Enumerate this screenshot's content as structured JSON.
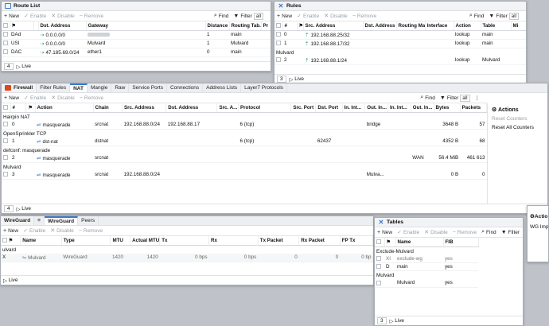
{
  "route_list": {
    "title": "Route List",
    "toolbar": {
      "new": "New",
      "enable": "Enable",
      "disable": "Disable",
      "remove": "Remove",
      "find": "Find",
      "filter": "Filter",
      "filter_value": "all"
    },
    "columns": [
      "",
      "",
      "",
      "Dst. Address",
      "Gateway",
      "Distance",
      "Routing Tab...",
      "Pr"
    ],
    "rows": [
      {
        "flag": "DAd",
        "dst": "0.0.0.0/0",
        "gw": "",
        "dist": "1",
        "table": "main"
      },
      {
        "flag": "USI",
        "dst": "0.0.0.0/0",
        "gw": "Mulvard",
        "dist": "1",
        "table": "Mulvard"
      },
      {
        "flag": "DAC",
        "dst": "47.185.69.0/24",
        "gw": "ether1",
        "dist": "0",
        "table": "main"
      }
    ],
    "footer": {
      "count": "4",
      "live": "Live"
    }
  },
  "rules": {
    "title": "Rules",
    "toolbar": {
      "new": "New",
      "enable": "Enable",
      "disable": "Disable",
      "remove": "Remove",
      "find": "Find",
      "filter": "Filter",
      "filter_value": "all"
    },
    "columns": [
      "",
      "#",
      "",
      "Src. Address",
      "Dst. Address",
      "Routing Mark",
      "Interface",
      "Action",
      "Table",
      "Mi"
    ],
    "rows": [
      {
        "num": "0",
        "src": "192.168.88.25/32",
        "action": "lookup",
        "table": "main"
      },
      {
        "num": "1",
        "src": "192.168.88.17/32",
        "action": "lookup",
        "table": "main"
      }
    ],
    "group": "Mulvard",
    "group_rows": [
      {
        "num": "2",
        "src": "192.168.88.1/24",
        "action": "lookup",
        "table": "Mulvard"
      }
    ],
    "footer": {
      "count": "3",
      "live": "Live"
    }
  },
  "firewall": {
    "title": "Firewall",
    "tabs": [
      "Filter Rules",
      "NAT",
      "Mangle",
      "Raw",
      "Service Ports",
      "Connections",
      "Address Lists",
      "Layer7 Protocols"
    ],
    "active_tab": "NAT",
    "toolbar": {
      "new": "New",
      "enable": "Enable",
      "disable": "Disable",
      "remove": "Remove",
      "find": "Find",
      "filter": "Filter",
      "filter_value": "all"
    },
    "columns": [
      "",
      "#",
      "",
      "Action",
      "Chain",
      "Src. Address",
      "Dst. Address",
      "Src. A...",
      "Protocol",
      "Src. Port",
      "Dst. Port",
      "In. Int...",
      "Out. In...",
      "In. Int...",
      "Out. In...",
      "Bytes",
      "Packets"
    ],
    "groups": [
      {
        "name": "Hairpin NAT",
        "rows": [
          {
            "num": "0",
            "action": "masquerade",
            "chain": "srcnat",
            "src": "192.168.88.0/24",
            "dst": "192.168.88.17",
            "protocol": "6 (tcp)",
            "dst_port": "",
            "out_if": "bridge",
            "out_if2": "",
            "bytes": "3648 B",
            "packets": "57"
          }
        ]
      },
      {
        "name": "OpenSprinkler TCP",
        "rows": [
          {
            "num": "1",
            "action": "dst-nat",
            "chain": "dstnat",
            "src": "",
            "dst": "",
            "protocol": "6 (tcp)",
            "dst_port": "62437",
            "out_if": "",
            "out_if2": "",
            "bytes": "4352 B",
            "packets": "68"
          }
        ]
      },
      {
        "name": "defconf: masquerade",
        "rows": [
          {
            "num": "2",
            "action": "masquerade",
            "chain": "srcnat",
            "src": "",
            "dst": "",
            "protocol": "",
            "dst_port": "",
            "out_if": "",
            "out_if2": "WAN",
            "bytes": "56.4 MiB",
            "packets": "461 613"
          }
        ]
      },
      {
        "name": "Mulvard",
        "rows": [
          {
            "num": "3",
            "action": "masquerade",
            "chain": "srcnat",
            "src": "192.168.88.0/24",
            "dst": "",
            "protocol": "",
            "dst_port": "",
            "out_if": "Mulva...",
            "out_if2": "",
            "bytes": "0 B",
            "packets": "0"
          }
        ]
      }
    ],
    "actions": {
      "title": "Actions",
      "reset": "Reset Counters",
      "reset_all": "Reset All Counters"
    },
    "footer": {
      "count": "4",
      "live": "Live"
    }
  },
  "wireguard": {
    "title": "WireGuard",
    "tabs": [
      "WireGuard",
      "Peers"
    ],
    "toolbar": {
      "new": "New",
      "enable": "Enable",
      "disable": "Disable",
      "remove": "Remove"
    },
    "columns": [
      "",
      "Name",
      "Type",
      "MTU",
      "Actual MTU",
      "Tx",
      "Rx",
      "Tx Packet",
      "Rx Packet",
      "FP Tx"
    ],
    "group": "ulvard",
    "rows": [
      {
        "flag": "X",
        "name": "Mulvard",
        "type": "WireGuard",
        "mtu": "1420",
        "actual_mtu": "1420",
        "tx": "0 bps",
        "rx": "0 bps",
        "tx_packet": "0",
        "rx_packet": "0",
        "fp_tx": "0 bp"
      }
    ],
    "footer": {
      "live": "Live"
    }
  },
  "tables": {
    "title": "Tables",
    "toolbar": {
      "new": "New",
      "enable": "Enable",
      "disable": "Disable",
      "remove": "Remove",
      "find": "Find",
      "filter": "Filter"
    },
    "columns": [
      "",
      "",
      "Name",
      "FIB"
    ],
    "groups": [
      {
        "name": "Exclude-Mulvard",
        "rows": [
          {
            "flag": "XI",
            "name": "exclude-wg",
            "fib": "yes",
            "dim": true
          },
          {
            "flag": "D",
            "name": "main",
            "fib": "yes",
            "dim": false
          }
        ]
      },
      {
        "name": "Mulvard",
        "rows": [
          {
            "flag": "",
            "name": "Mulvard",
            "fib": "yes",
            "dim": false
          }
        ]
      }
    ],
    "footer": {
      "count": "3",
      "live": "Live"
    }
  },
  "right_stub": {
    "actions": "Actio",
    "item": "WG Impo"
  }
}
